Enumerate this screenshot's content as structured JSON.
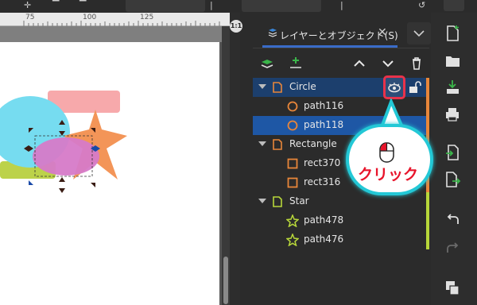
{
  "ruler": {
    "labels": [
      "75",
      "100",
      "125"
    ]
  },
  "zoom_badge": "1:1",
  "panel": {
    "tab_label": "レイヤーとオブジェクト(S)",
    "tab_close": "✕"
  },
  "tree": {
    "rows": [
      {
        "label": "Circle",
        "kind": "layer",
        "state": "selected-parent"
      },
      {
        "label": "path116",
        "kind": "circle",
        "state": "normal"
      },
      {
        "label": "path118",
        "kind": "circle",
        "state": "selected"
      },
      {
        "label": "Rectangle",
        "kind": "layer",
        "state": "normal"
      },
      {
        "label": "rect370",
        "kind": "rect",
        "state": "normal"
      },
      {
        "label": "rect316",
        "kind": "rect",
        "state": "normal"
      },
      {
        "label": "Star",
        "kind": "layer",
        "state": "normal"
      },
      {
        "label": "path478",
        "kind": "star",
        "state": "normal"
      },
      {
        "label": "path476",
        "kind": "star",
        "state": "normal"
      }
    ]
  },
  "annotation": {
    "text": "クリック"
  },
  "colors": {
    "selection": "#1e57a5",
    "layer_icon_orange": "#e8863a",
    "star_green": "#b7d63a",
    "accent_cyan": "#23c8d6",
    "highlight_red": "#e8324a"
  }
}
